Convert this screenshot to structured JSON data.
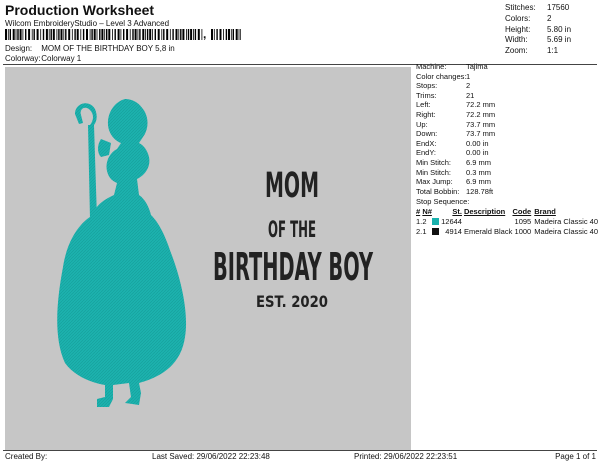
{
  "header": {
    "title": "Production Worksheet",
    "software": "Wilcom EmbroideryStudio – Level 3 Advanced",
    "design_label": "Design:",
    "design_value": "MOM OF THE BIRTHDAY BOY 5,8 in",
    "colorway_label": "Colorway:",
    "colorway_value": "Colorway 1"
  },
  "stats": [
    {
      "label": "Stitches:",
      "value": "17560"
    },
    {
      "label": "Colors:",
      "value": "2"
    },
    {
      "label": "Height:",
      "value": "5.80 in"
    },
    {
      "label": "Width:",
      "value": "5.69 in"
    },
    {
      "label": "Zoom:",
      "value": "1:1"
    }
  ],
  "design_text": {
    "line1": "MOM",
    "line2": "OF THE",
    "line3": "BIRTHDAY BOY",
    "line4": "EST. 2020"
  },
  "properties": [
    {
      "label": "Machine:",
      "value": "Tajima"
    },
    {
      "label": "Color changes:",
      "value": "1"
    },
    {
      "label": "Stops:",
      "value": "2"
    },
    {
      "label": "Trims:",
      "value": "21"
    },
    {
      "label": "Left:",
      "value": "72.2 mm"
    },
    {
      "label": "Right:",
      "value": "72.2 mm"
    },
    {
      "label": "Up:",
      "value": "73.7 mm"
    },
    {
      "label": "Down:",
      "value": "73.7 mm"
    },
    {
      "label": "EndX:",
      "value": "0.00 in"
    },
    {
      "label": "EndY:",
      "value": "0.00 in"
    },
    {
      "label": "Min Stitch:",
      "value": "6.9 mm"
    },
    {
      "label": "Min Stitch:",
      "value": "0.3 mm"
    },
    {
      "label": "Max Jump:",
      "value": "6.9 mm"
    },
    {
      "label": "Total Bobbin:",
      "value": "128.78ft"
    }
  ],
  "stop_sequence": {
    "title": "Stop Sequence:",
    "headers": [
      "#",
      "N#",
      "St.",
      "Description",
      "Code",
      "Brand"
    ],
    "rows": [
      {
        "num": "1.",
        "n": "2",
        "color": "#1ab1ad",
        "st": "12644",
        "desc": "",
        "code": "1095",
        "brand": "Madeira Classic 40"
      },
      {
        "num": "2.",
        "n": "1",
        "color": "#111111",
        "st": "4914",
        "desc": "Emerald Black",
        "code": "1000",
        "brand": "Madeira Classic 40"
      }
    ]
  },
  "footer": {
    "created": "Created By:",
    "saved": "Last Saved: 29/06/2022 22:23:48",
    "printed": "Printed: 29/06/2022 22:23:51",
    "page": "Page 1 of 1"
  }
}
